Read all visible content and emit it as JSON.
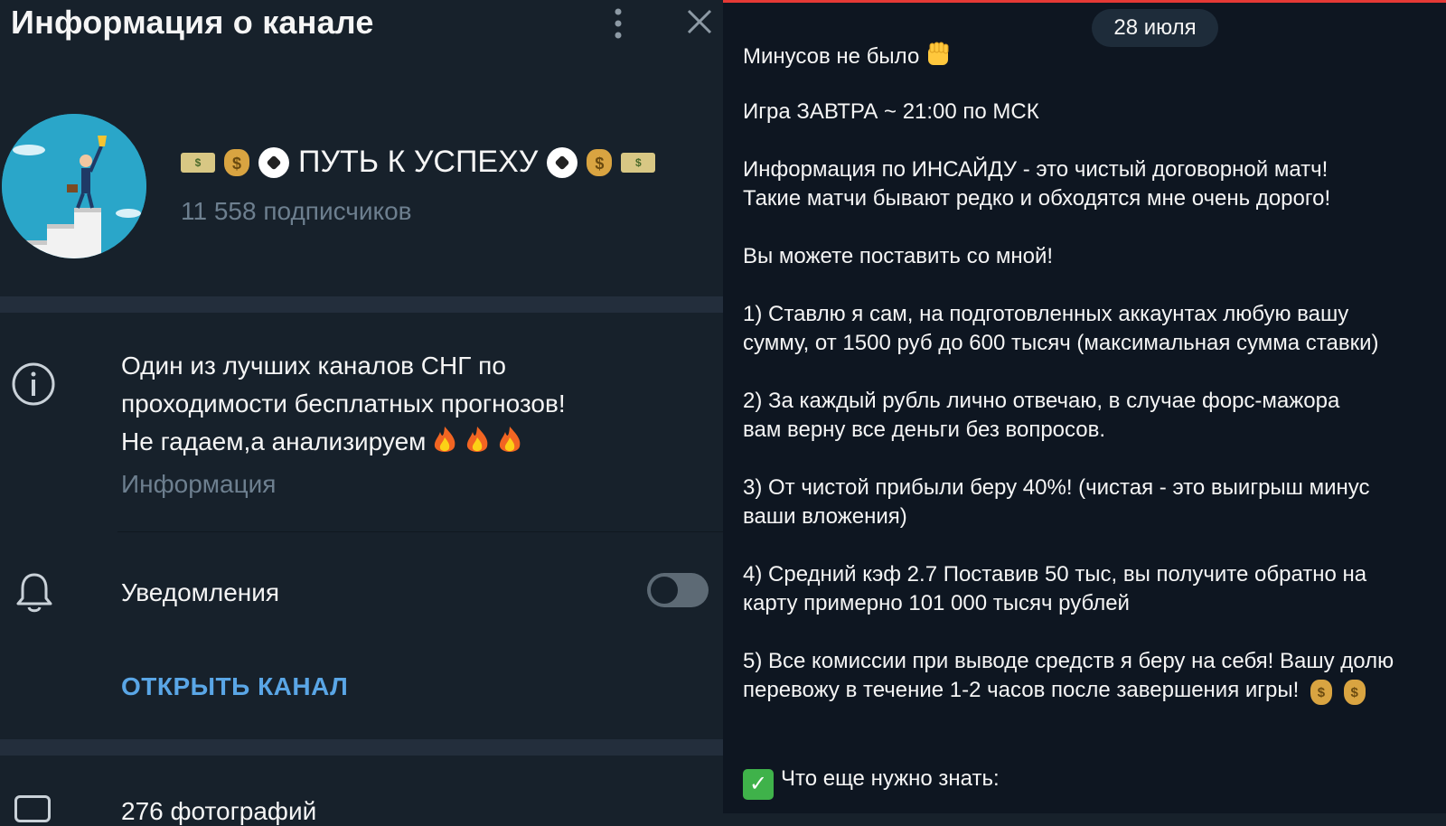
{
  "header": {
    "title": "Информация о канале"
  },
  "channel": {
    "name": "ПУТЬ К УСПЕХУ",
    "subscribers": "11 558 подписчиков",
    "description_lines": [
      "Один из лучших каналов СНГ по",
      "проходимости бесплатных прогнозов!",
      "Не гадаем,а анализируем"
    ],
    "description_label": "Информация",
    "notifications_label": "Уведомления",
    "notifications_enabled": false,
    "open_channel_label": "ОТКРЫТЬ КАНАЛ",
    "partial_row_text": "276 фотографий"
  },
  "messages": {
    "date": "28 июля",
    "lines": [
      {
        "text": "Минусов не было",
        "bold": false
      },
      {
        "text": "Игра ЗАВТРА ~ 21:00 по МСК",
        "bold": false
      },
      {
        "text": "Информация по ИНСАЙДУ - это чистый договорной матч!",
        "bold": true
      },
      {
        "text": "Такие матчи бывают редко и обходятся мне очень дорого!",
        "bold": false
      },
      {
        "text": "Вы можете поставить со мной!",
        "bold": true
      },
      {
        "text": "1) Ставлю я сам, на подготовленных аккаунтах любую вашу",
        "bold": false
      },
      {
        "text": "сумму, от 1500 руб до  600 тысяч (максимальная сумма ставки)",
        "bold": false
      },
      {
        "text": "2) За каждый рубль лично отвечаю, в случае форс-мажора",
        "bold": true
      },
      {
        "text": "вам верну все деньги без вопросов.",
        "bold": true
      },
      {
        "text": "3) От чистой прибыли беру 40%! (чистая - это выигрыш минус",
        "bold": false
      },
      {
        "text": "ваши вложения)",
        "bold": false
      },
      {
        "text": "4) Средний кэф 2.7 Поставив 50 тыс, вы получите обратно на",
        "bold": true
      },
      {
        "text": "карту примерно 101 000 тысяч рублей",
        "bold": true
      },
      {
        "text": "5) Все комиссии при выводе средств я беру на себя! Вашу долю",
        "bold": false
      },
      {
        "text": "перевожу в течение 1-2 часов после завершения игры!",
        "bold": false
      },
      {
        "text": "Что еще нужно знать:",
        "bold": true
      }
    ]
  },
  "colors": {
    "panel_bg": "#17212b",
    "chat_bg": "#0e1621",
    "accent_link": "#5aa6e6",
    "muted_text": "#6d7f8f"
  },
  "icons": [
    "more-vertical-icon",
    "close-icon",
    "info-icon",
    "bell-icon",
    "fire-icon",
    "fist-icon",
    "money-bag-icon",
    "check-mark-icon"
  ]
}
